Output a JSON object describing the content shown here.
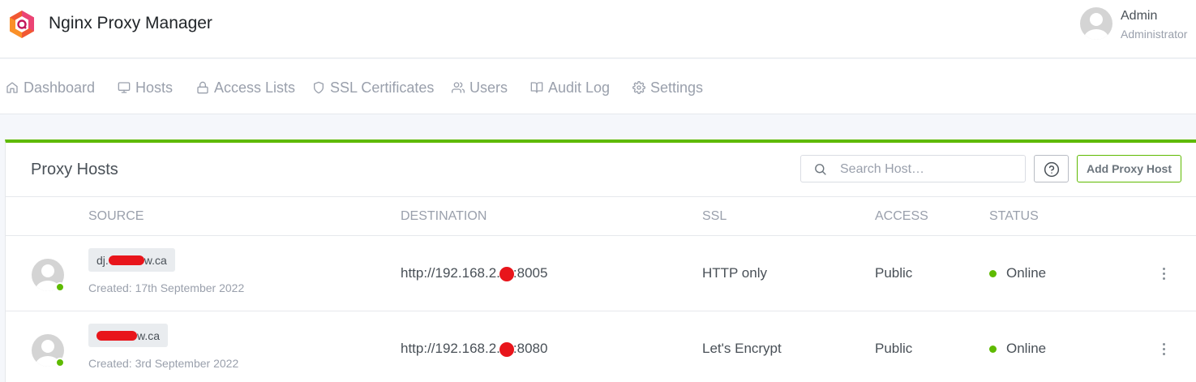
{
  "app": {
    "brand": "Nginx Proxy Manager",
    "accent_color": "#5eba00",
    "logo_icon": "hexagon-logo-icon"
  },
  "user": {
    "name": "Admin",
    "role": "Administrator",
    "avatar_icon": "user-avatar-icon"
  },
  "nav": {
    "items": [
      {
        "label": "Dashboard",
        "icon": "home-icon"
      },
      {
        "label": "Hosts",
        "icon": "monitor-icon"
      },
      {
        "label": "Access Lists",
        "icon": "lock-icon"
      },
      {
        "label": "SSL Certificates",
        "icon": "shield-icon"
      },
      {
        "label": "Users",
        "icon": "users-icon"
      },
      {
        "label": "Audit Log",
        "icon": "book-open-icon"
      },
      {
        "label": "Settings",
        "icon": "settings-icon"
      }
    ]
  },
  "card": {
    "title": "Proxy Hosts",
    "search_placeholder": "Search Host…",
    "help_icon": "help-circle-icon",
    "add_button": "Add Proxy Host"
  },
  "table": {
    "columns": [
      "SOURCE",
      "DESTINATION",
      "SSL",
      "ACCESS",
      "STATUS"
    ],
    "rows": [
      {
        "source_prefix": "dj.",
        "source_suffix": "w.ca",
        "created": "Created: 17th September 2022",
        "dest_prefix": "http://192.168.2.",
        "dest_suffix": ":8005",
        "ssl": "HTTP only",
        "access": "Public",
        "status": "Online"
      },
      {
        "source_prefix": "",
        "source_suffix": "w.ca",
        "created": "Created: 3rd September 2022",
        "dest_prefix": "http://192.168.2.",
        "dest_suffix": ":8080",
        "ssl": "Let's Encrypt",
        "access": "Public",
        "status": "Online"
      }
    ]
  }
}
